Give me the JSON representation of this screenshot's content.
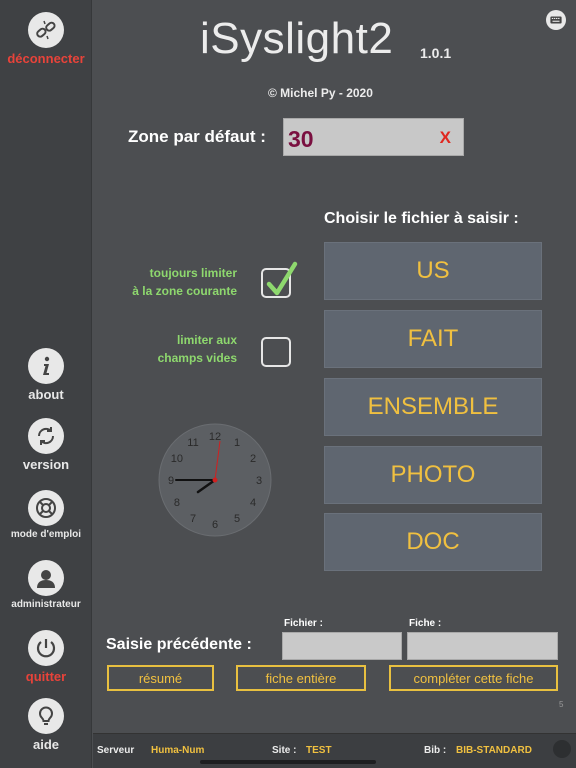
{
  "app": {
    "title": "iSyslight2",
    "version": "1.0.1",
    "copyright": "© Michel Py - 2020"
  },
  "sidebar": {
    "disconnect": "déconnecter",
    "about": "about",
    "version": "version",
    "manual": "mode d'emploi",
    "admin": "administrateur",
    "quit": "quitter",
    "help": "aide"
  },
  "zone": {
    "label": "Zone par défaut :",
    "value": "30",
    "clear": "X"
  },
  "options": {
    "limit_zone_line1": "toujours limiter",
    "limit_zone_line2": "à la zone courante",
    "limit_zone_checked": true,
    "limit_empty_line1": "limiter aux",
    "limit_empty_line2": "champs vides",
    "limit_empty_checked": false
  },
  "files": {
    "header": "Choisir le fichier à saisir :",
    "items": [
      "US",
      "FAIT",
      "ENSEMBLE",
      "PHOTO",
      "DOC"
    ]
  },
  "clock": {
    "numbers": [
      "12",
      "1",
      "2",
      "3",
      "4",
      "5",
      "6",
      "7",
      "8",
      "9",
      "10",
      "11"
    ]
  },
  "previous": {
    "label": "Saisie précédente :",
    "fichier_label": "Fichier :",
    "fiche_label": "Fiche :",
    "fichier_value": "",
    "fiche_value": "",
    "btn_summary": "résumé",
    "btn_full": "fiche entière",
    "btn_complete": "compléter cette fiche",
    "page": "5"
  },
  "footer": {
    "server_label": "Serveur",
    "server_value": "Huma-Num",
    "site_label": "Site :",
    "site_value": "TEST",
    "bib_label": "Bib :",
    "bib_value": "BIB-STANDARD"
  },
  "colors": {
    "accent_yellow": "#f0c040",
    "option_green": "#8ed86e",
    "danger_red": "#e8433a"
  }
}
